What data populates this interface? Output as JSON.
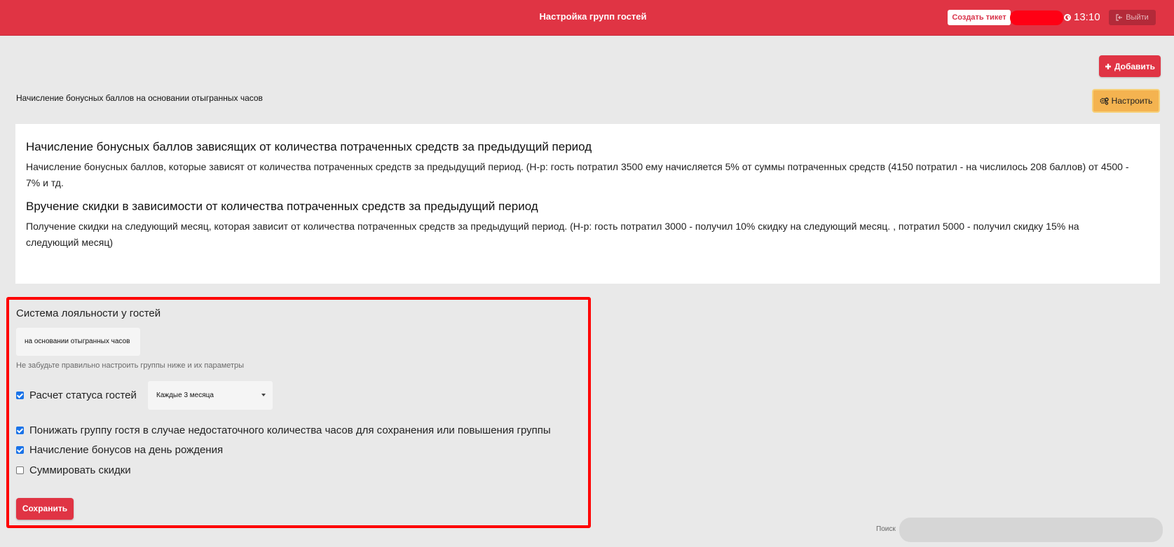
{
  "header": {
    "title": "Настройка групп гостей",
    "ticket_button": "Создать тикет",
    "time": "13:10",
    "exit_button": "Выйти",
    "brand_color": "#e03444"
  },
  "toolbar": {
    "add_button": "Добавить",
    "configure_button": "Настроить"
  },
  "subtitle": "Начисление бонусных баллов на основании отыгранных часов",
  "info": {
    "section1_title": "Начисление бонусных баллов зависящих от количества потраченных средств за предыдущий период",
    "section1_text": "Начисление бонусных баллов, которые зависят от количества потраченных средств за предыдущий период. (Н-р: гость потратил 3500 ему начисляется 5% от суммы потраченных средств (4150 потратил - на числилось 208 баллов) от 4500 - 7% и тд.",
    "section2_title": "Вручение скидки в зависимости от количества потраченных средств за предыдущий период",
    "section2_text": "Получение скидки на следующий месяц, которая зависит от количества потраченных средств за предыдущий период. (Н-р: гость потратил 3000 - получил 10% скидку на следующий месяц. , потратил 5000 - получил скидку 15% на следующий месяц)"
  },
  "loyalty": {
    "heading": "Система лояльности у гостей",
    "system_value": "на основании отыгранных часов",
    "hint": "Не забудьте правильно настроить группы ниже и их параметры",
    "status_calc_label": "Расчет статуса гостей",
    "status_calc_checked": true,
    "period_value": "Каждые 3 месяца",
    "downgrade_label": "Понижать группу гостя в случае недостаточного количества часов для сохранения или повышения группы",
    "downgrade_checked": true,
    "birthday_label": "Начисление бонусов на день рождения",
    "birthday_checked": true,
    "sum_discounts_label": "Суммировать скидки",
    "sum_discounts_checked": false,
    "save_button": "Сохранить"
  },
  "search": {
    "label": "Поиск",
    "value": ""
  }
}
